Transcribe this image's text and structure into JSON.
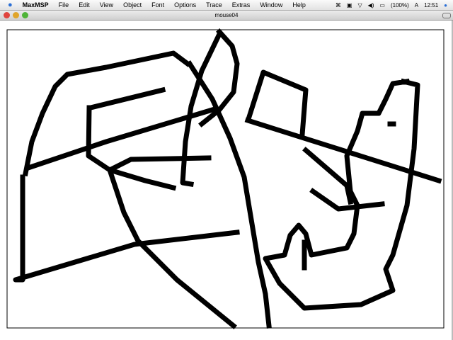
{
  "menubar": {
    "app": "MaxMSP",
    "items": [
      "File",
      "Edit",
      "View",
      "Object",
      "Font",
      "Options",
      "Trace",
      "Extras",
      "Window",
      "Help"
    ],
    "battery": "(100%)",
    "clock": "12:51"
  },
  "window": {
    "title": "mouse04"
  },
  "colors": {
    "stroke": "#000000",
    "close": "#e0443e",
    "minimize": "#e0a52a",
    "zoom": "#4fb438"
  }
}
